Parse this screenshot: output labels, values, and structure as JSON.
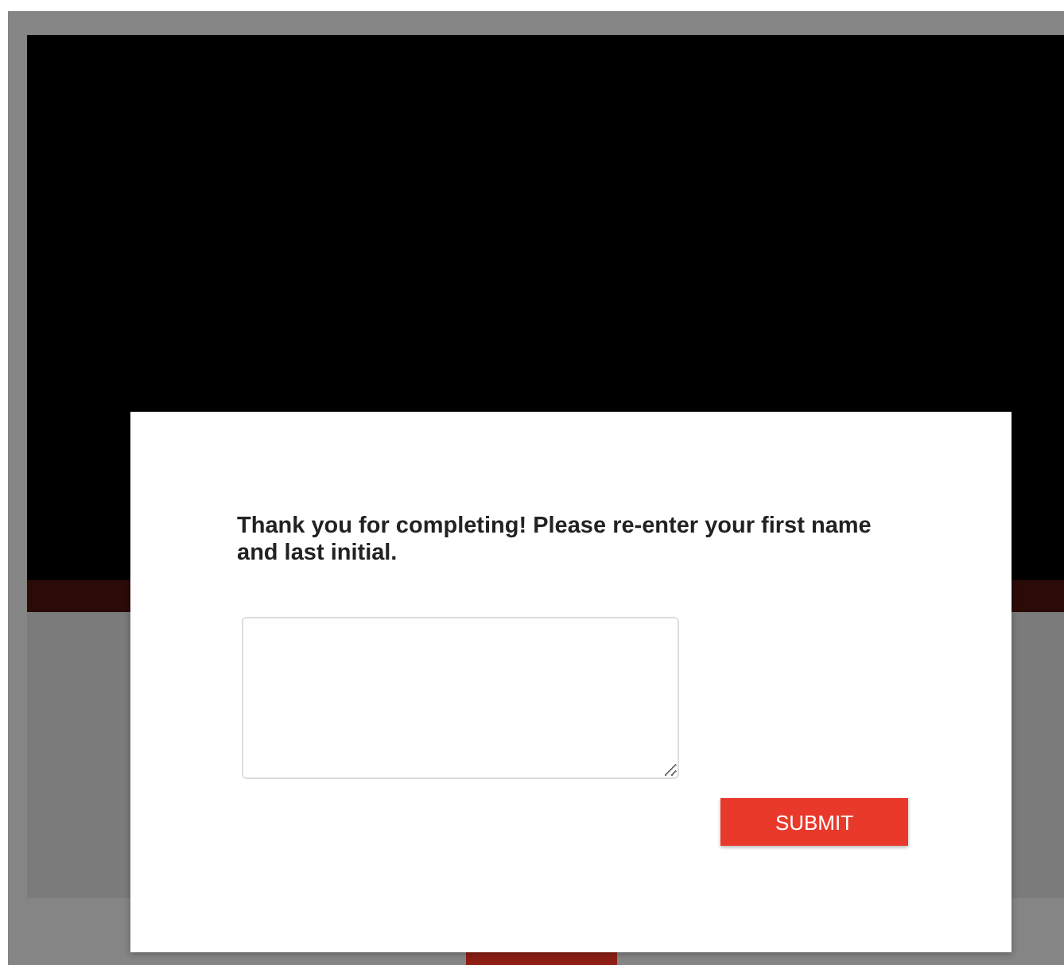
{
  "dialog": {
    "message": "Thank you for completing! Please re-enter your first name and last initial.",
    "submit_button": "SUBMIT"
  }
}
